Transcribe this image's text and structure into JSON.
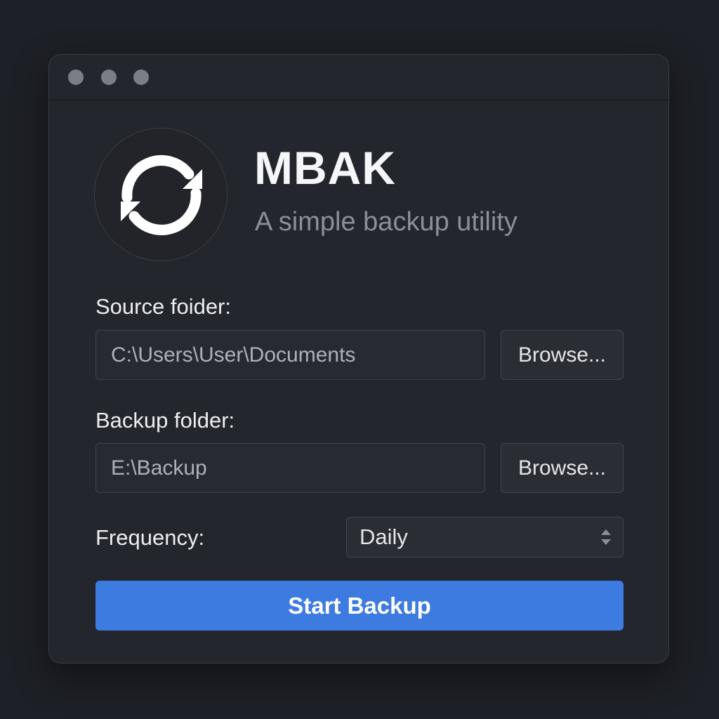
{
  "window": {
    "controls": [
      "close",
      "minimize",
      "maximize"
    ]
  },
  "header": {
    "logo_icon": "sync-arrows-icon",
    "title": "MBAK",
    "subtitle": "A simple backup utility"
  },
  "form": {
    "source": {
      "label": "Source foider:",
      "value": "C:\\Users\\User\\Documents",
      "browse_label": "Browse..."
    },
    "backup": {
      "label": "Backup folder:",
      "value": "E:\\Backup",
      "browse_label": "Browse..."
    },
    "frequency": {
      "label": "Frequency:",
      "selected": "Daily",
      "icon": "updown-chevron-icon"
    },
    "start_label": "Start Backup"
  },
  "colors": {
    "accent": "#3d7be0",
    "background": "#24262d",
    "page_background": "#1e2027",
    "title_text": "#f5f6f8",
    "subtitle_text": "#8c8f97",
    "traffic_light": "#7b7e86"
  }
}
